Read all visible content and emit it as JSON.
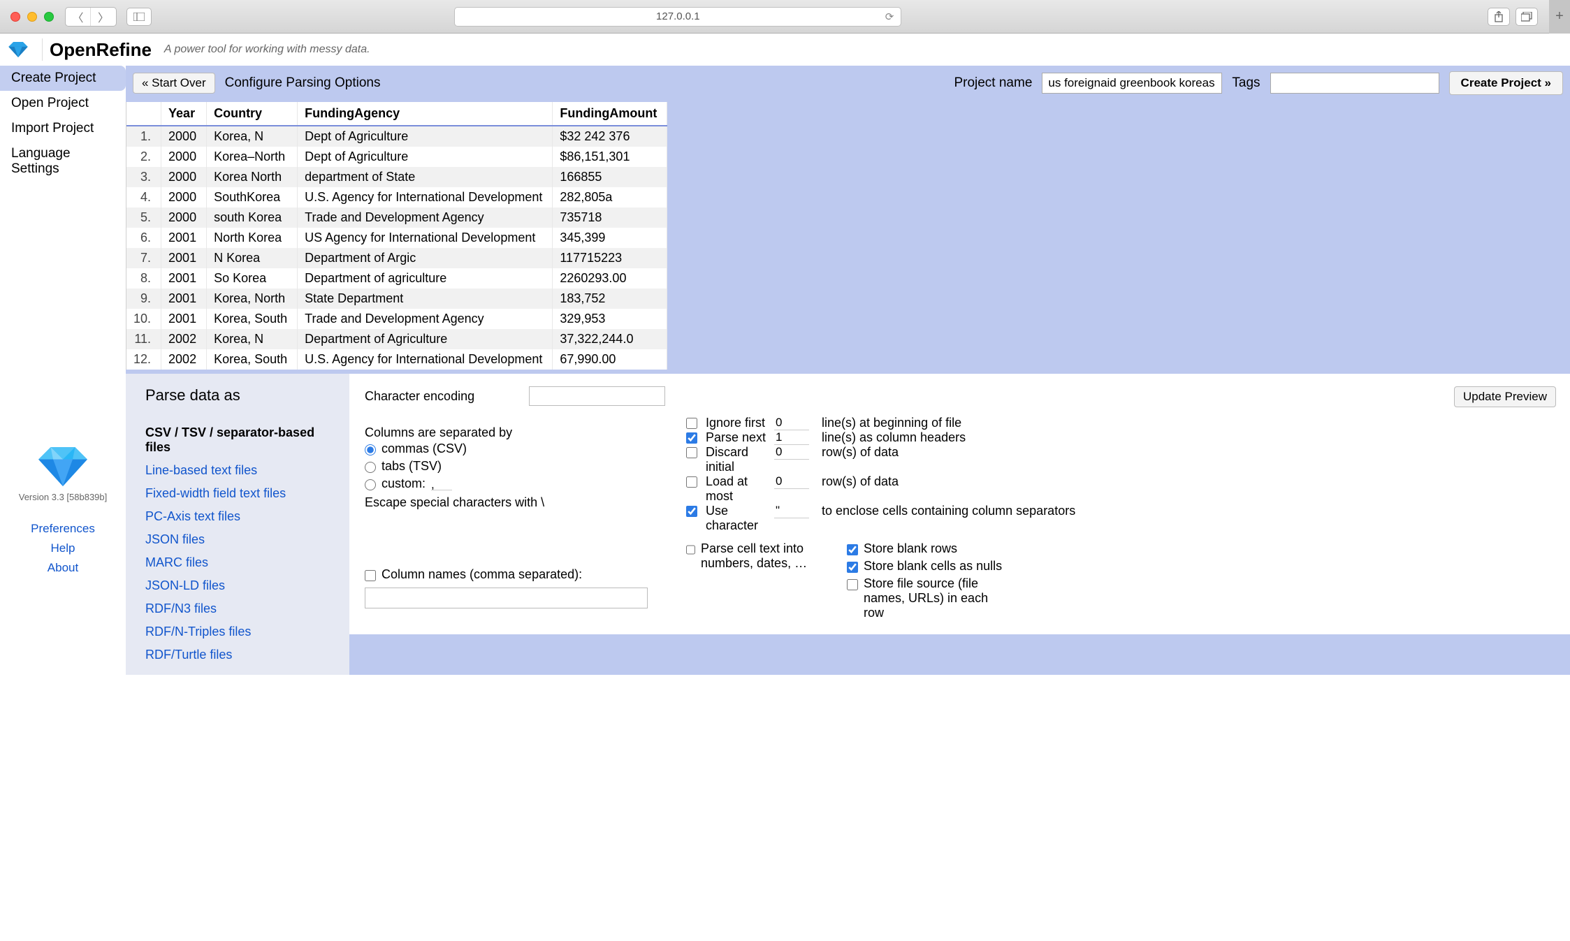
{
  "browser": {
    "url": "127.0.0.1"
  },
  "app": {
    "name": "OpenRefine",
    "tagline": "A power tool for working with messy data."
  },
  "leftNav": {
    "items": [
      "Create Project",
      "Open Project",
      "Import Project",
      "Language Settings"
    ],
    "version": "Version 3.3 [58b839b]",
    "links": [
      "Preferences",
      "Help",
      "About"
    ]
  },
  "actionBar": {
    "startOver": "« Start Over",
    "configure": "Configure Parsing Options",
    "projectNameLabel": "Project name",
    "projectName": "us foreignaid greenbook koreas csv",
    "tagsLabel": "Tags",
    "createBtn": "Create Project »"
  },
  "table": {
    "headers": [
      "Year",
      "Country",
      "FundingAgency",
      "FundingAmount"
    ],
    "rows": [
      {
        "n": "1.",
        "year": "2000",
        "country": "Korea, N",
        "agency": "Dept of Agriculture",
        "amount": "$32 242 376"
      },
      {
        "n": "2.",
        "year": "2000",
        "country": "Korea–North",
        "agency": "Dept of Agriculture",
        "amount": "$86,151,301"
      },
      {
        "n": "3.",
        "year": "2000",
        "country": "Korea North",
        "agency": "department of State",
        "amount": "166855"
      },
      {
        "n": "4.",
        "year": "2000",
        "country": "SouthKorea",
        "agency": "U.S. Agency for International Development",
        "amount": "282,805a"
      },
      {
        "n": "5.",
        "year": "2000",
        "country": "south Korea",
        "agency": "Trade and Development Agency",
        "amount": "   735718"
      },
      {
        "n": "6.",
        "year": "2001",
        "country": "North Korea",
        "agency": "US Agency for International Development",
        "amount": "345,399"
      },
      {
        "n": "7.",
        "year": "2001",
        "country": "N Korea",
        "agency": "Department of Argic",
        "amount": "   117715223"
      },
      {
        "n": "8.",
        "year": "2001",
        "country": "So Korea",
        "agency": "Department of agriculture",
        "amount": "2260293.00"
      },
      {
        "n": "9.",
        "year": "2001",
        "country": "Korea, North",
        "agency": "State Department",
        "amount": "183,752"
      },
      {
        "n": "10.",
        "year": "2001",
        "country": "Korea, South",
        "agency": "Trade and Development Agency",
        "amount": "329,953"
      },
      {
        "n": "11.",
        "year": "2002",
        "country": "Korea, N",
        "agency": "Department of Agriculture",
        "amount": "37,322,244.0"
      },
      {
        "n": "12.",
        "year": "2002",
        "country": "Korea, South",
        "agency": "U.S. Agency for International Development",
        "amount": "67,990.00"
      }
    ]
  },
  "parse": {
    "title": "Parse data as",
    "formats": [
      "CSV / TSV / separator-based files",
      "Line-based text files",
      "Fixed-width field text files",
      "PC-Axis text files",
      "JSON files",
      "MARC files",
      "JSON-LD files",
      "RDF/N3 files",
      "RDF/N-Triples files",
      "RDF/Turtle files"
    ],
    "encodingLabel": "Character encoding",
    "updateBtn": "Update Preview",
    "sepLabel": "Columns are separated by",
    "sepOptions": {
      "csv": "commas (CSV)",
      "tsv": "tabs (TSV)",
      "custom": "custom:"
    },
    "customSepValue": ",",
    "escapeLabel": "Escape special characters with \\",
    "colNamesLabel": "Column names (comma separated):",
    "opts": {
      "ignoreFirst": {
        "label1": "Ignore first",
        "value": "0",
        "label2": "line(s) at beginning of file"
      },
      "parseNext": {
        "label1": "Parse next",
        "value": "1",
        "label2": "line(s) as column headers"
      },
      "discard": {
        "label1": "Discard initial",
        "value": "0",
        "label2": "row(s) of data"
      },
      "loadAtMost": {
        "label1": "Load at most",
        "value": "0",
        "label2": "row(s) of data"
      },
      "useChar": {
        "label1": "Use character",
        "value": "\"",
        "label2": "to enclose cells containing column separators"
      }
    },
    "parseCell": "Parse cell text into numbers, dates, …",
    "storeBlankRows": "Store blank rows",
    "storeBlankCells": "Store blank cells as nulls",
    "storeFileSource": "Store file source (file names, URLs) in each row"
  }
}
